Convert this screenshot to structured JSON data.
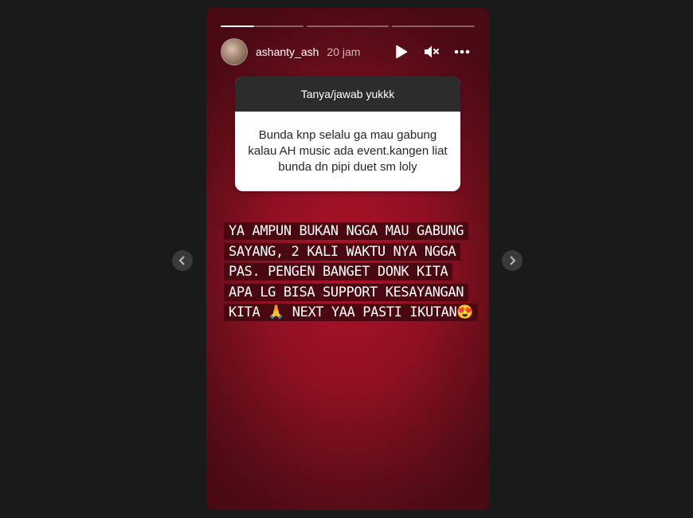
{
  "story": {
    "username": "ashanty_ash",
    "time": "20 jam",
    "progress_segments": 3,
    "current_segment": 0
  },
  "question_box": {
    "title": "Tanya/jawab yukkk",
    "question": "Bunda knp selalu ga mau gabung kalau AH music ada event.kangen liat bunda dn pipi duet sm loly"
  },
  "answer": {
    "text": "YA AMPUN BUKAN NGGA MAU GABUNG SAYANG, 2 KALI WAKTU NYA NGGA PAS. PENGEN BANGET DONK KITA APA LG BISA SUPPORT KESAYANGAN KITA 🙏 NEXT YAA PASTI IKUTAN😍"
  },
  "controls": {
    "play_icon": "play-icon",
    "mute_icon": "mute-icon",
    "more_icon": "more-icon"
  },
  "colors": {
    "background": "#1a1a1a",
    "story_red": "#8d1022",
    "answer_highlight": "#4a0810"
  }
}
